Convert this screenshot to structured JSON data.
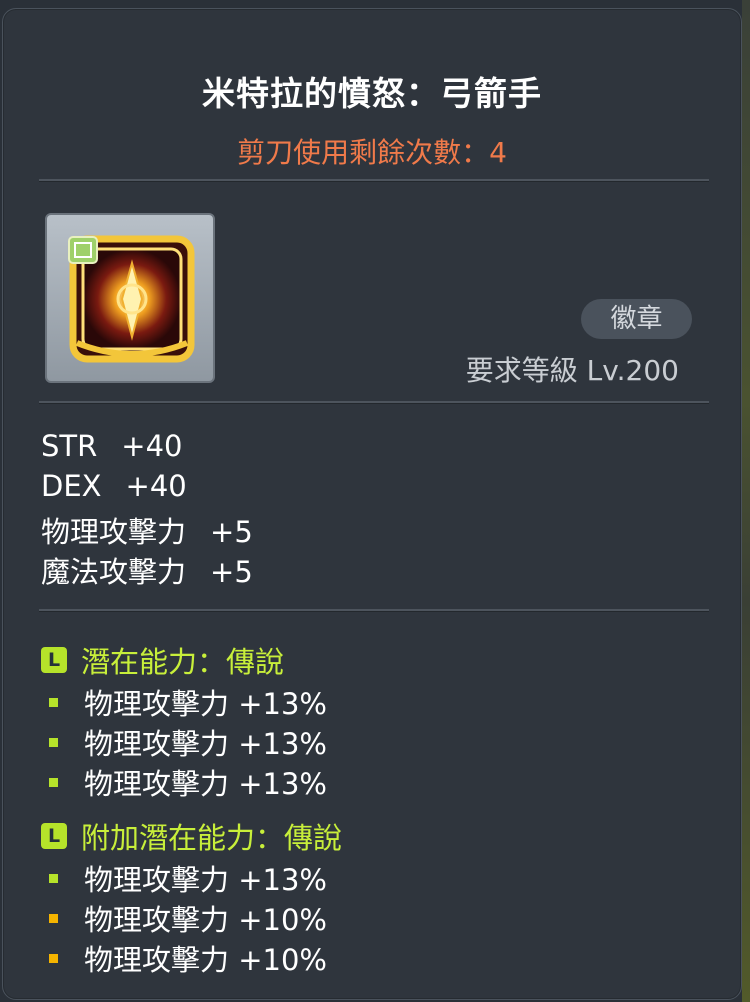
{
  "item": {
    "title": "米特拉的憤怒：弓箭手",
    "scissors": "剪刀使用剩餘次數：4",
    "type_badge": "徽章",
    "requirement": "要求等級 Lv.200"
  },
  "stats": [
    {
      "name": "STR",
      "value": "+40"
    },
    {
      "name": "DEX",
      "value": "+40"
    },
    {
      "name": "物理攻擊力",
      "value": "+5"
    },
    {
      "name": "魔法攻擊力",
      "value": "+5"
    }
  ],
  "potential": {
    "badge": "L",
    "header": "潛在能力：傳說",
    "lines": [
      "物理攻擊力 +13%",
      "物理攻擊力 +13%",
      "物理攻擊力 +13%"
    ],
    "dot_colors": [
      "#b6e32a",
      "#b6e32a",
      "#b6e32a"
    ]
  },
  "bonus_potential": {
    "badge": "L",
    "header": "附加潛在能力：傳說",
    "lines": [
      "物理攻擊力 +13%",
      "物理攻擊力 +10%",
      "物理攻擊力 +10%"
    ],
    "dot_colors": [
      "#b6e32a",
      "#f5b400",
      "#f5b400"
    ]
  },
  "colors": {
    "title": "#ffffff",
    "scissors": "#f07a4a",
    "legendary": "#c8ef3a",
    "unique_dot": "#f5b400"
  },
  "icons": {
    "item": "emblem-icon"
  }
}
